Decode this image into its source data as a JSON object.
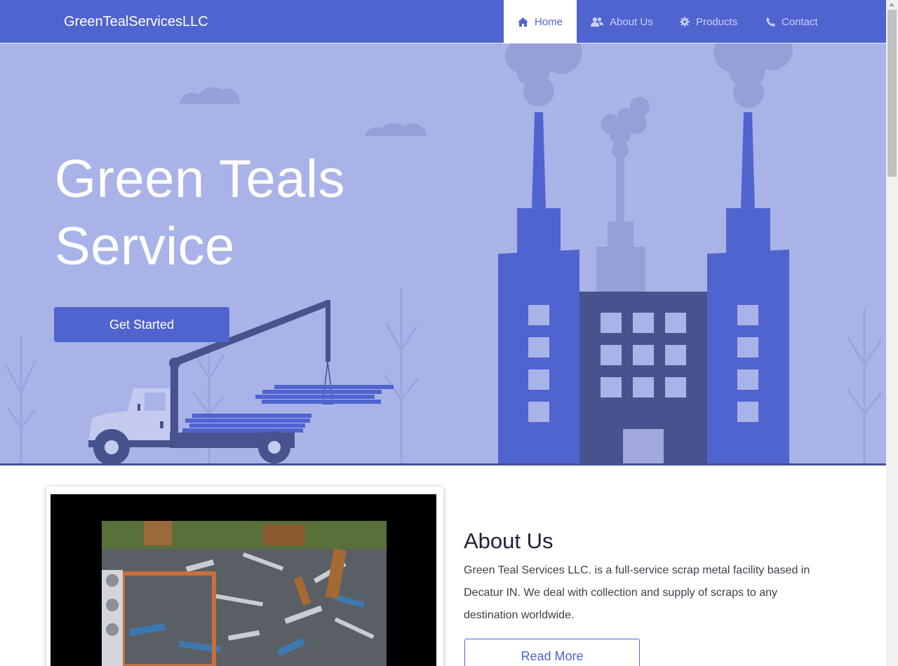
{
  "navbar": {
    "brand": "GreenTealServicesLLC",
    "items": [
      {
        "label": "Home",
        "icon": "home-icon",
        "active": true
      },
      {
        "label": "About Us",
        "icon": "users-icon",
        "active": false
      },
      {
        "label": "Products",
        "icon": "gear-icon",
        "active": false
      },
      {
        "label": "Contact",
        "icon": "phone-icon",
        "active": false
      }
    ]
  },
  "hero": {
    "title_line1": "Green Teals",
    "title_line2": "Service",
    "cta_label": "Get Started"
  },
  "about": {
    "heading": "About Us",
    "text": "Green Teal Services LLC. is a full-service scrap metal facility based in Decatur IN. We deal with collection and supply of scraps to any destination worldwide.",
    "button_label": "Read More"
  },
  "colors": {
    "primary": "#5064cf",
    "hero_bg": "#aab3e8",
    "dark_building": "#47528e",
    "white": "#ffffff"
  }
}
